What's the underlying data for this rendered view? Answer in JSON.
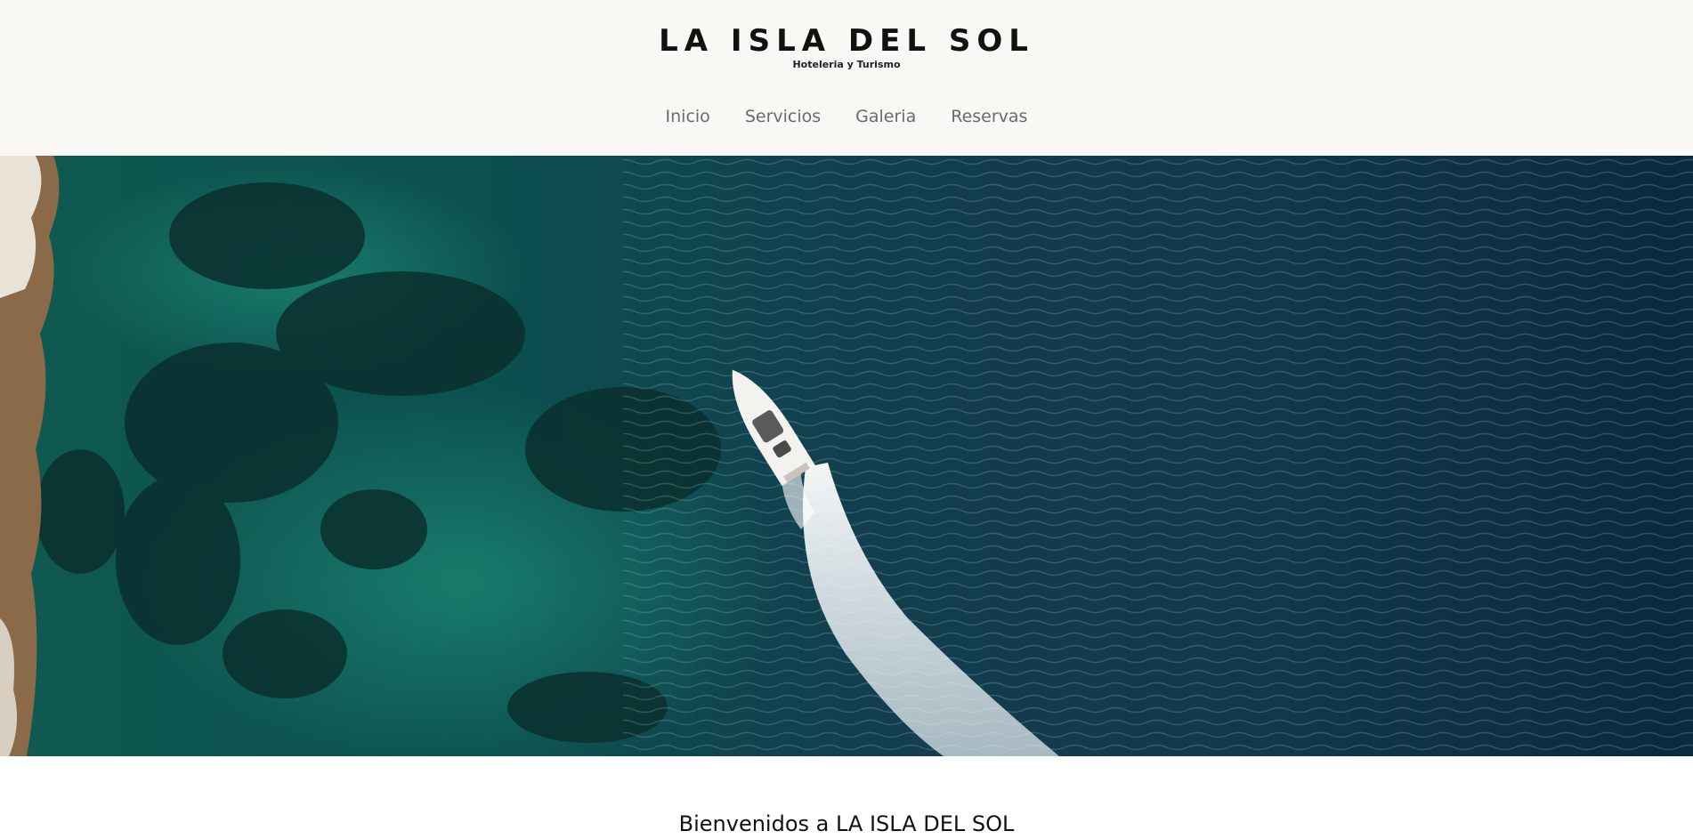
{
  "header": {
    "title": "LA ISLA DEL SOL",
    "subtitle": "Hoteleria y Turismo"
  },
  "nav": {
    "items": [
      {
        "label": "Inicio"
      },
      {
        "label": "Servicios"
      },
      {
        "label": "Galeria"
      },
      {
        "label": "Reservas"
      }
    ]
  },
  "hero": {
    "image": "aerial-speedboat-ocean"
  },
  "welcome": {
    "heading": "Bienvenidos a LA ISLA DEL SOL"
  },
  "colors": {
    "header_bg": "#f9f8f4",
    "nav_text": "#6a6a6a",
    "title_text": "#111111"
  }
}
